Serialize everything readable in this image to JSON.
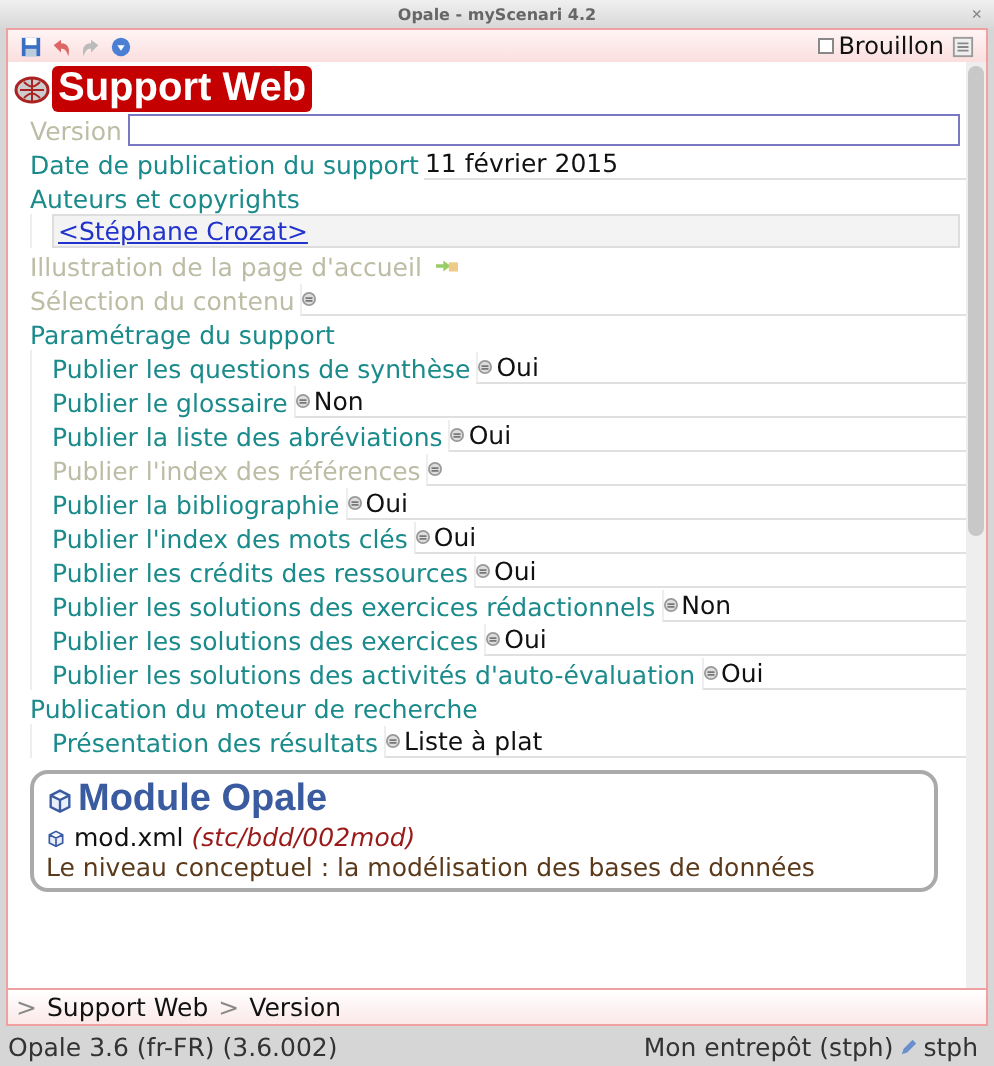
{
  "window": {
    "title": "Opale - myScenari 4.2",
    "close": "×"
  },
  "draft": {
    "label": "Brouillon",
    "checked": false
  },
  "doc_title": "Support Web",
  "entries": [
    {
      "kind": "input",
      "label": "Version",
      "disabled": true
    },
    {
      "kind": "value",
      "label": "Date de publication du support",
      "value": "11 février 2015",
      "disabled": false
    },
    {
      "kind": "group",
      "label": "Auteurs et copyrights",
      "disabled": false,
      "children": [
        {
          "kind": "link",
          "label": "<Stéphane Crozat>",
          "disabled": false
        }
      ]
    },
    {
      "kind": "image",
      "label": "Illustration de la page d'accueil",
      "disabled": true
    },
    {
      "kind": "option",
      "label": "Sélection du contenu",
      "disabled": true
    },
    {
      "kind": "group",
      "label": "Paramétrage du support",
      "disabled": false,
      "children": [
        {
          "kind": "option",
          "label": "Publier les questions de synthèse",
          "value": "Oui",
          "disabled": false
        },
        {
          "kind": "option",
          "label": "Publier le glossaire",
          "value": "Non",
          "disabled": false
        },
        {
          "kind": "option",
          "label": "Publier la liste des abréviations",
          "value": "Oui",
          "disabled": false
        },
        {
          "kind": "option",
          "label": "Publier l'index des références",
          "disabled": true
        },
        {
          "kind": "option",
          "label": "Publier la bibliographie",
          "value": "Oui",
          "disabled": false
        },
        {
          "kind": "option",
          "label": "Publier l'index des mots clés",
          "value": "Oui",
          "disabled": false
        },
        {
          "kind": "option",
          "label": "Publier les crédits des ressources",
          "value": "Oui",
          "disabled": false
        },
        {
          "kind": "option",
          "label": "Publier les solutions des exercices rédactionnels",
          "value": "Non",
          "disabled": false
        },
        {
          "kind": "option",
          "label": "Publier les solutions des exercices",
          "value": "Oui",
          "disabled": false
        },
        {
          "kind": "option",
          "label": "Publier les solutions des activités d'auto-évaluation",
          "value": "Oui",
          "disabled": false
        }
      ]
    },
    {
      "kind": "group",
      "label": "Publication du moteur de recherche",
      "disabled": false,
      "children": [
        {
          "kind": "option",
          "label": "Présentation des résultats",
          "value": "Liste à plat",
          "disabled": false
        }
      ]
    }
  ],
  "module": {
    "title": "Module Opale",
    "file": "mod.xml",
    "path": "(stc/bdd/002mod)",
    "description": "Le niveau conceptuel : la modélisation des bases de données"
  },
  "breadcrumb": [
    {
      "separator": ">",
      "label": "Support Web"
    },
    {
      "separator": ">",
      "label": "Version"
    }
  ],
  "status_bar": {
    "version": "Opale 3.6 (fr-FR) (3.6.002)",
    "store": "Mon entrepôt (stph)",
    "user": "stph"
  }
}
